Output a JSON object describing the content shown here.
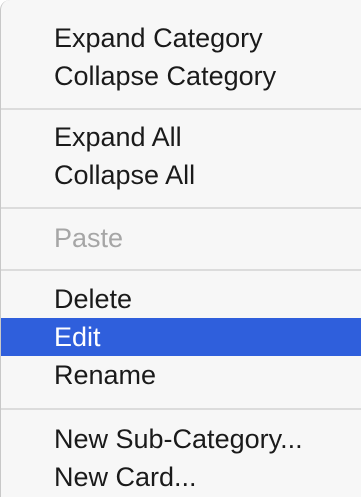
{
  "menu": {
    "items": [
      {
        "label": "Expand Category",
        "enabled": true
      },
      {
        "label": "Collapse Category",
        "enabled": true
      },
      {
        "label": "Expand All",
        "enabled": true
      },
      {
        "label": "Collapse All",
        "enabled": true
      },
      {
        "label": "Paste",
        "enabled": false
      },
      {
        "label": "Delete",
        "enabled": true
      },
      {
        "label": "Edit",
        "enabled": true,
        "selected": true
      },
      {
        "label": "Rename",
        "enabled": true
      },
      {
        "label": "New Sub-Category...",
        "enabled": true
      },
      {
        "label": "New Card...",
        "enabled": true
      }
    ],
    "colors": {
      "highlight": "#2f5fdc",
      "disabled_text": "#a6a6a6",
      "background": "#f7f7f7"
    }
  }
}
